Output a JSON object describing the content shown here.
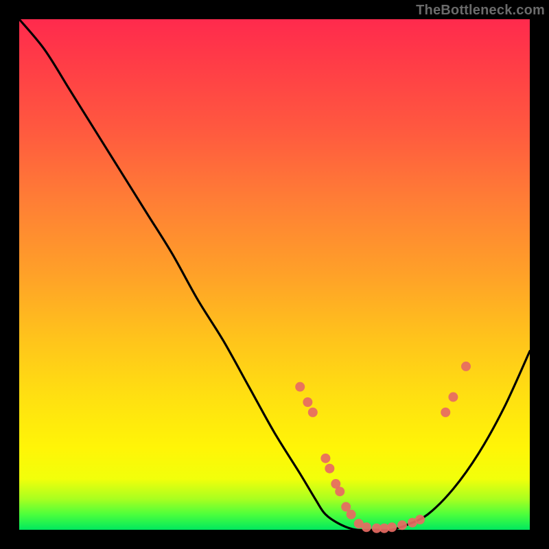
{
  "watermark": "TheBottleneck.com",
  "colors": {
    "curve_stroke": "#000000",
    "marker_fill": "#e76a63",
    "background": "#000000"
  },
  "chart_data": {
    "type": "line",
    "title": "",
    "xlabel": "",
    "ylabel": "",
    "xlim": [
      0,
      100
    ],
    "ylim": [
      0,
      100
    ],
    "series": [
      {
        "name": "bottleneck-curve",
        "x": [
          0,
          5,
          10,
          15,
          20,
          25,
          30,
          35,
          40,
          45,
          50,
          55,
          58,
          60,
          63,
          66,
          70,
          73,
          76,
          80,
          85,
          90,
          95,
          100
        ],
        "y": [
          100,
          94,
          86,
          78,
          70,
          62,
          54,
          45,
          37,
          28,
          19,
          11,
          6,
          3,
          1,
          0,
          0,
          0,
          1,
          3,
          8,
          15,
          24,
          35
        ]
      }
    ],
    "markers": [
      {
        "name": "left-cluster",
        "points": [
          {
            "x": 55,
            "y": 28
          },
          {
            "x": 56.5,
            "y": 25
          },
          {
            "x": 57.5,
            "y": 23
          },
          {
            "x": 60,
            "y": 14
          },
          {
            "x": 60.8,
            "y": 12
          },
          {
            "x": 62,
            "y": 9
          },
          {
            "x": 62.8,
            "y": 7.5
          },
          {
            "x": 64,
            "y": 4.5
          },
          {
            "x": 65,
            "y": 3
          }
        ]
      },
      {
        "name": "bottom-cluster",
        "points": [
          {
            "x": 66.5,
            "y": 1.2
          },
          {
            "x": 68,
            "y": 0.5
          },
          {
            "x": 70,
            "y": 0.3
          },
          {
            "x": 71.5,
            "y": 0.3
          },
          {
            "x": 73,
            "y": 0.5
          },
          {
            "x": 75,
            "y": 0.9
          },
          {
            "x": 77,
            "y": 1.4
          },
          {
            "x": 78.5,
            "y": 2
          }
        ]
      },
      {
        "name": "right-cluster",
        "points": [
          {
            "x": 83.5,
            "y": 23
          },
          {
            "x": 85,
            "y": 26
          },
          {
            "x": 87.5,
            "y": 32
          }
        ]
      }
    ]
  }
}
